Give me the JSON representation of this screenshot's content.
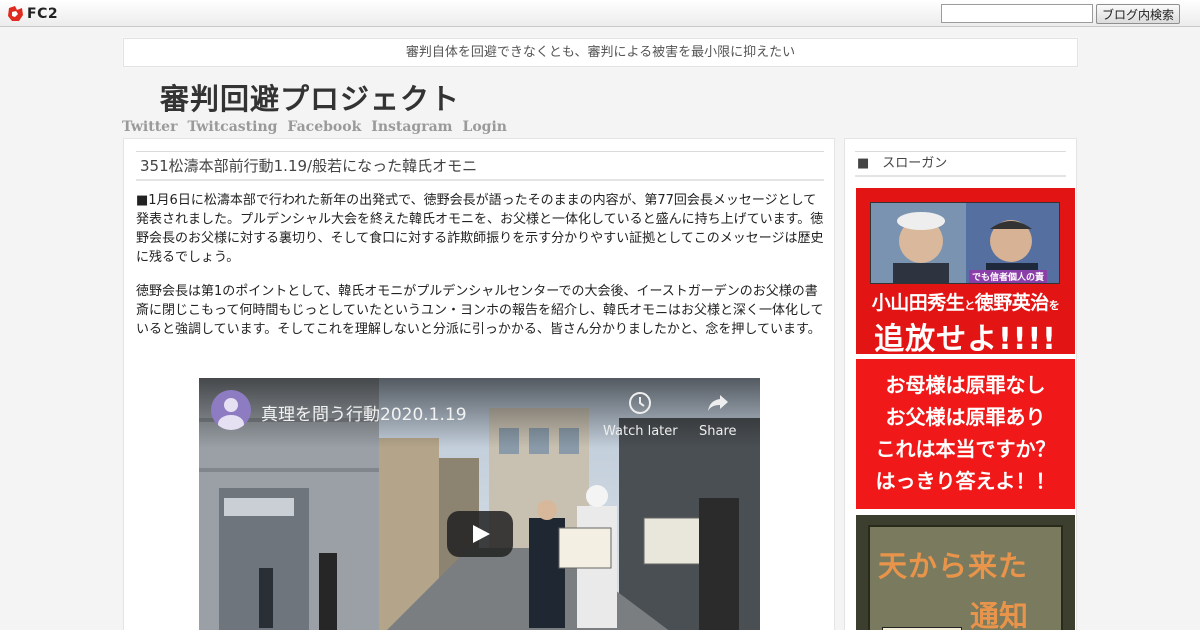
{
  "fc2bar": {
    "logo_text": "FC2",
    "search_placeholder": "",
    "search_button": "ブログ内検索"
  },
  "tagline": "審判自体を回避できなくとも、審判による被害を最小限に抑えたい",
  "site_title": "審判回避プロジェクト",
  "nav": [
    "Twitter",
    "Twitcasting",
    "Facebook",
    "Instagram",
    "Login"
  ],
  "post": {
    "title": "351松濤本部前行動1.19/般若になった韓氏オモニ",
    "paragraphs": [
      "■1月6日に松濤本部で行われた新年の出発式で、徳野会長が語ったそのままの内容が、第77回会長メッセージとして発表されました。プルデンシャル大会を終えた韓氏オモニを、お父様と一体化していると盛んに持ち上げています。徳野会長のお父様に対する裏切り、そして食口に対する詐欺師振りを示す分かりやすい証拠としてこのメッセージは歴史に残るでしょう。",
      "徳野会長は第1のポイントとして、韓氏オモニがプルデンシャルセンターでの大会後、イーストガーデンのお父様の書斎に閉じこもって何時間もじっとしていたというユン・ヨンホの報告を紹介し、韓氏オモニはお父様と深く一体化していると強調しています。そしてこれを理解しないと分派に引っかかる、皆さん分かりましたかと、念を押しています。"
    ],
    "video": {
      "title": "真理を問う行動2020.1.19",
      "watch_later": "Watch later",
      "share": "Share"
    }
  },
  "sidebar": {
    "heading": "■　スローガン",
    "banner1": {
      "tag": "でも信者個人の責",
      "name1": "小山田秀生",
      "conj": "と",
      "name2": "徳野英治",
      "particle": "を",
      "headline": "追放せよ!!!!"
    },
    "banner2": {
      "lines": [
        "お母様は原罪なし",
        "お父様は原罪あり",
        "これは本当ですか？",
        "はっきり答えよ！！"
      ]
    },
    "banner3": {
      "line1": "天から来た",
      "line2": "通知"
    }
  },
  "colors": {
    "banner_red": "#e31414",
    "nav_gray": "#9a9a9a"
  }
}
